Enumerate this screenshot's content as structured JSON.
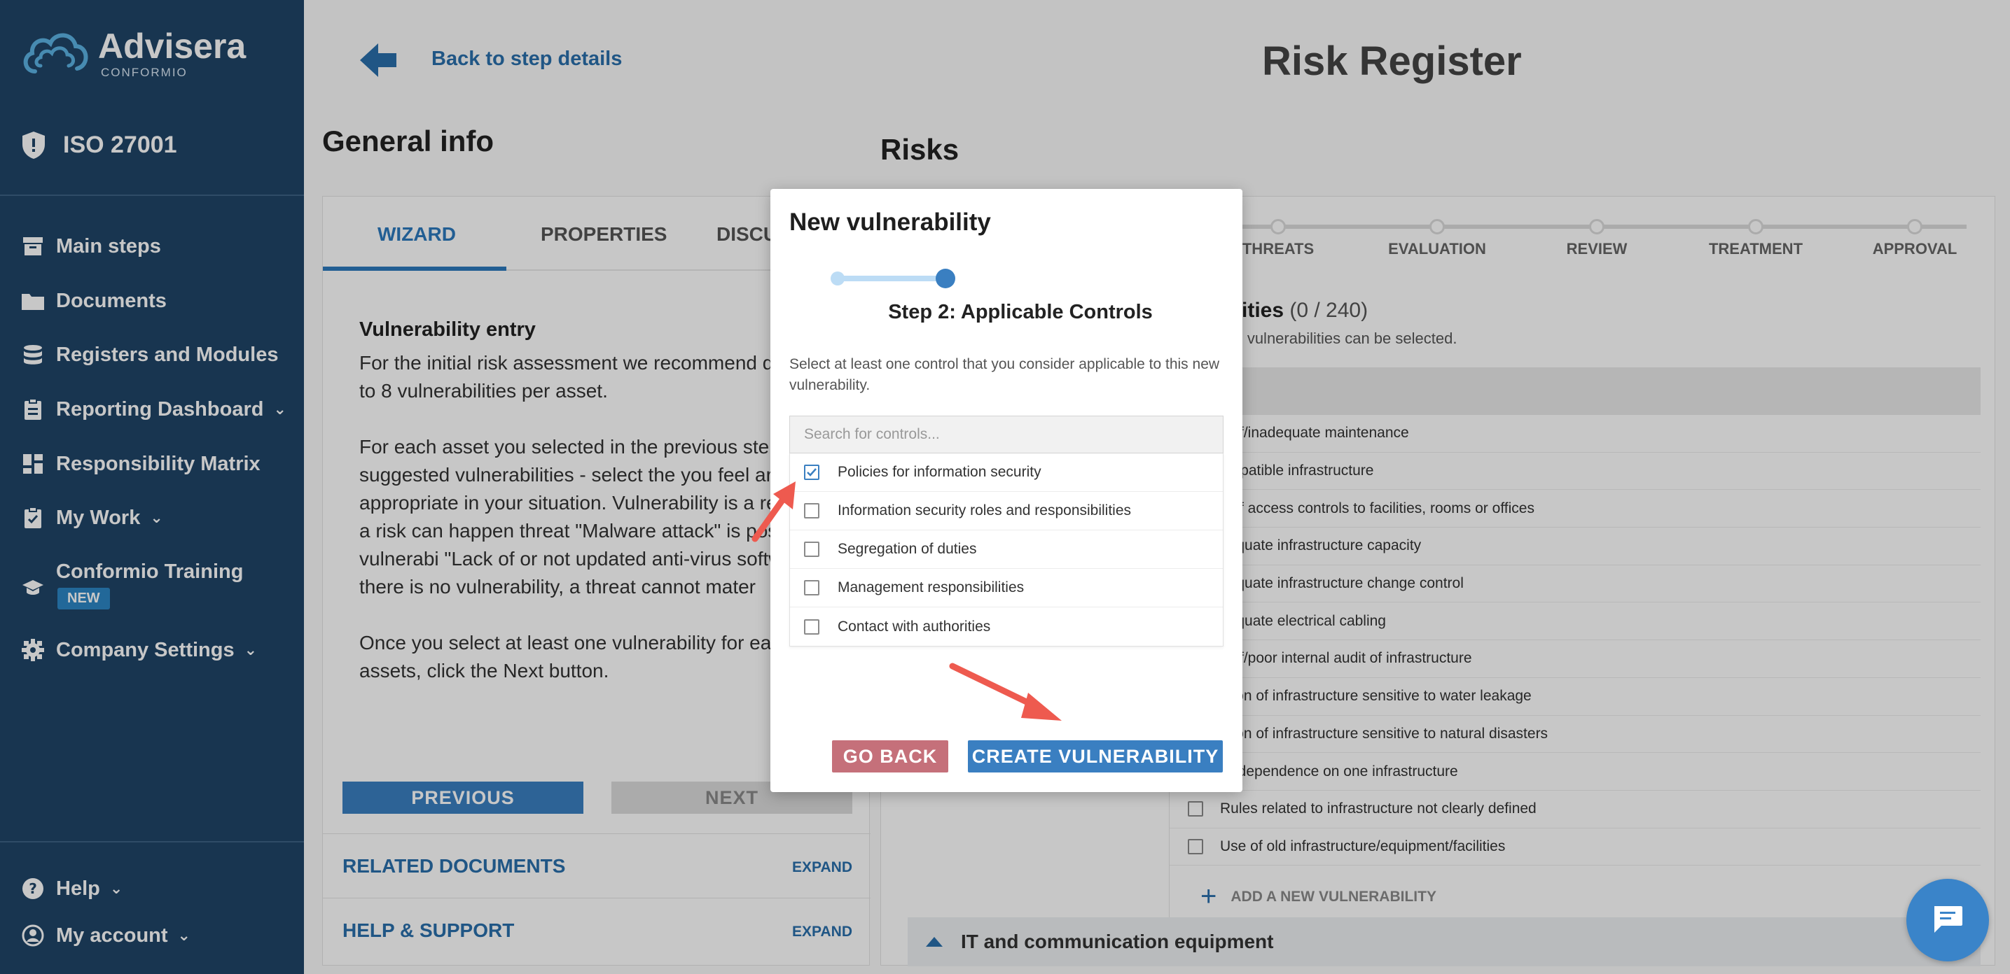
{
  "app": {
    "logo_title": "Advisera",
    "logo_sub": "CONFORMIO",
    "standard": "ISO 27001"
  },
  "sidebar": {
    "items": [
      {
        "label": "Main steps",
        "icon": "archive-icon"
      },
      {
        "label": "Documents",
        "icon": "folder-icon"
      },
      {
        "label": "Registers and Modules",
        "icon": "database-icon"
      },
      {
        "label": "Reporting Dashboard",
        "icon": "clipboard-icon"
      },
      {
        "label": "Responsibility Matrix",
        "icon": "grid-icon"
      },
      {
        "label": "My Work",
        "icon": "clipboard-check-icon"
      },
      {
        "label": "Conformio Training",
        "icon": "graduation-cap-icon",
        "badge": "NEW"
      },
      {
        "label": "Company Settings",
        "icon": "gear-icon"
      }
    ],
    "bottom": [
      {
        "label": "Help",
        "icon": "help-circle-icon"
      },
      {
        "label": "My account",
        "icon": "user-circle-icon"
      }
    ]
  },
  "header": {
    "back_label": "Back to step details",
    "title": "Risk Register"
  },
  "general": {
    "heading": "General info",
    "tabs": [
      "WIZARD",
      "PROPERTIES",
      "DISCU"
    ],
    "entry_title": "Vulnerability entry",
    "p1": "For the initial risk assessment we recommend defining up to 8 vulnerabilities per asset.",
    "p2": "For each asset you selected in the previous ste see some suggested vulnerabilities - select the you feel are appropriate in your situation. Vulnerability is a reason why a risk can happen threat \"Malware attack\" is possible if vulnerabi \"Lack of or not updated anti-virus software\" ex there is no vulnerability, a threat cannot mater",
    "p3": "Once you select at least one vulnerability for ea your assets, click the Next button.",
    "previous": "PREVIOUS",
    "next": "NEXT",
    "related_docs": "RELATED DOCUMENTS",
    "help_support": "HELP & SUPPORT",
    "expand": "EXPAND"
  },
  "risks": {
    "heading": "Risks",
    "steps": [
      "THREATS",
      "EVALUATION",
      "REVIEW",
      "TREATMENT",
      "APPROVAL"
    ],
    "vuln_heading": "bilities",
    "vuln_count": "(0 / 240)",
    "vuln_sub": "240 vulnerabilities can be selected.",
    "vulnerabilities": [
      "k of/inadequate maintenance",
      "ompatible infrastructure",
      "k of access controls to facilities, rooms or offices",
      "dequate infrastructure capacity",
      "dequate infrastructure change control",
      "dequate electrical cabling",
      "k of/poor internal audit of infrastructure",
      "ation of infrastructure sensitive to water leakage",
      "ation of infrastructure sensitive to natural disasters",
      "er-dependence on one infrastructure",
      "Rules related to infrastructure not clearly defined",
      "Use of old infrastructure/equipment/facilities"
    ],
    "add_vuln": "ADD A NEW VULNERABILITY",
    "it_group": "IT and communication equipment"
  },
  "modal": {
    "title": "New vulnerability",
    "step": "Step 2: Applicable Controls",
    "desc": "Select at least one control that you consider applicable to this new vulnerability.",
    "search_placeholder": "Search for controls...",
    "controls": [
      {
        "label": "Policies for information security",
        "checked": true
      },
      {
        "label": "Information security roles and responsibilities",
        "checked": false
      },
      {
        "label": "Segregation of duties",
        "checked": false
      },
      {
        "label": "Management responsibilities",
        "checked": false
      },
      {
        "label": "Contact with authorities",
        "checked": false
      }
    ],
    "go_back": "GO BACK",
    "create": "CREATE VULNERABILITY"
  },
  "colors": {
    "sidebar": "#1f4467",
    "accent": "#3a7fc1",
    "go_back": "#c5707a",
    "annotation_arrow": "#ee5a4f"
  }
}
